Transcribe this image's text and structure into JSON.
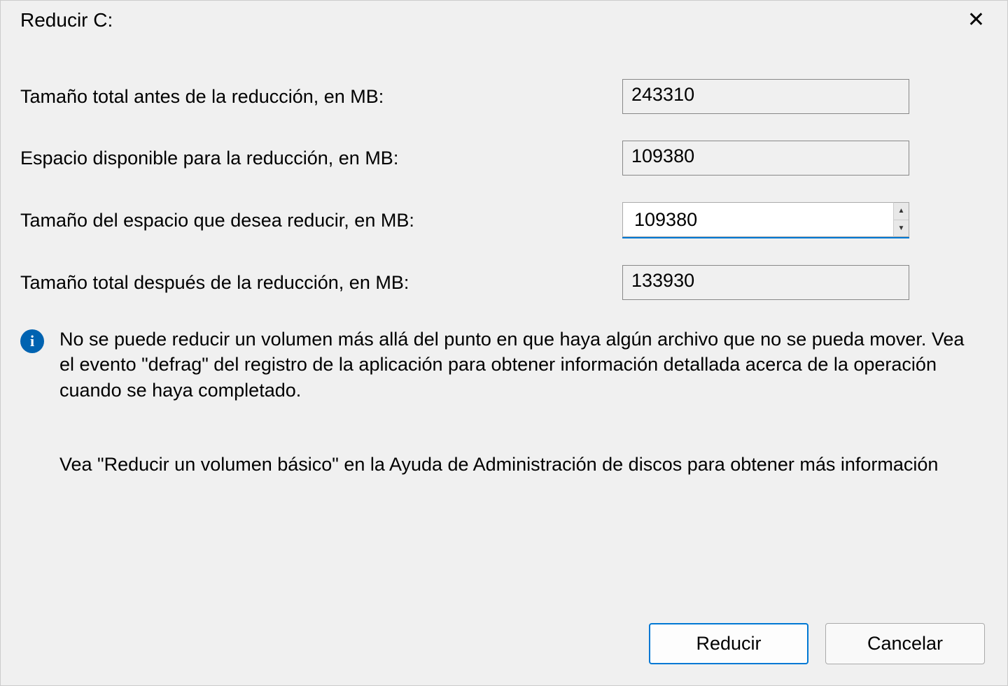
{
  "dialog": {
    "title": "Reducir C:",
    "fields": {
      "total_before": {
        "label": "Tamaño total antes de la reducción, en MB:",
        "value": "243310"
      },
      "available": {
        "label": "Espacio disponible para la reducción, en MB:",
        "value": "109380"
      },
      "shrink_amount": {
        "label": "Tamaño del espacio que desea reducir, en MB:",
        "value": "109380"
      },
      "total_after": {
        "label": "Tamaño total después de la reducción, en MB:",
        "value": "133930"
      }
    },
    "info_text": "No se puede reducir un volumen más allá del punto en que haya algún archivo que no se pueda mover. Vea el evento \"defrag\" del registro de la aplicación para obtener información detallada acerca de la operación cuando se haya completado.",
    "help_text": "Vea \"Reducir un volumen básico\"  en la Ayuda de Administración de discos para obtener más información",
    "buttons": {
      "ok": "Reducir",
      "cancel": "Cancelar"
    }
  }
}
